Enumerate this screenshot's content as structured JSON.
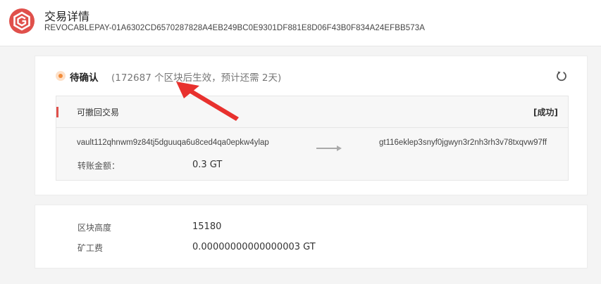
{
  "header": {
    "title": "交易详情",
    "tx_hash": "REVOCABLEPAY-01A6302CD6570287828A4EB249BC0E9301DF881E8D06F43B0F834A24EFBB573A",
    "logo_icon": "app-logo-icon"
  },
  "status": {
    "label": "待确认",
    "note": "(172687 个区块后生效，预计还需 2天)",
    "dot_color": "#f28c3a",
    "refresh_icon": "refresh-icon"
  },
  "transaction": {
    "type": "可撤回交易",
    "result": "[成功]",
    "from": "vault112qhnwm9z84tj5dguuqa6u8ced4qa0epkw4ylap",
    "to": "gt116eklep3snyf0jgwyn3r2nh3rh3v78txqvw97ff",
    "amount_label": "转账金额：",
    "amount_value": "0.3 GT",
    "accent_color": "#e0504b"
  },
  "details": {
    "block_height_label": "区块高度",
    "block_height_value": "15180",
    "fee_label": "矿工费",
    "fee_value": "0.00000000000000003 GT"
  }
}
